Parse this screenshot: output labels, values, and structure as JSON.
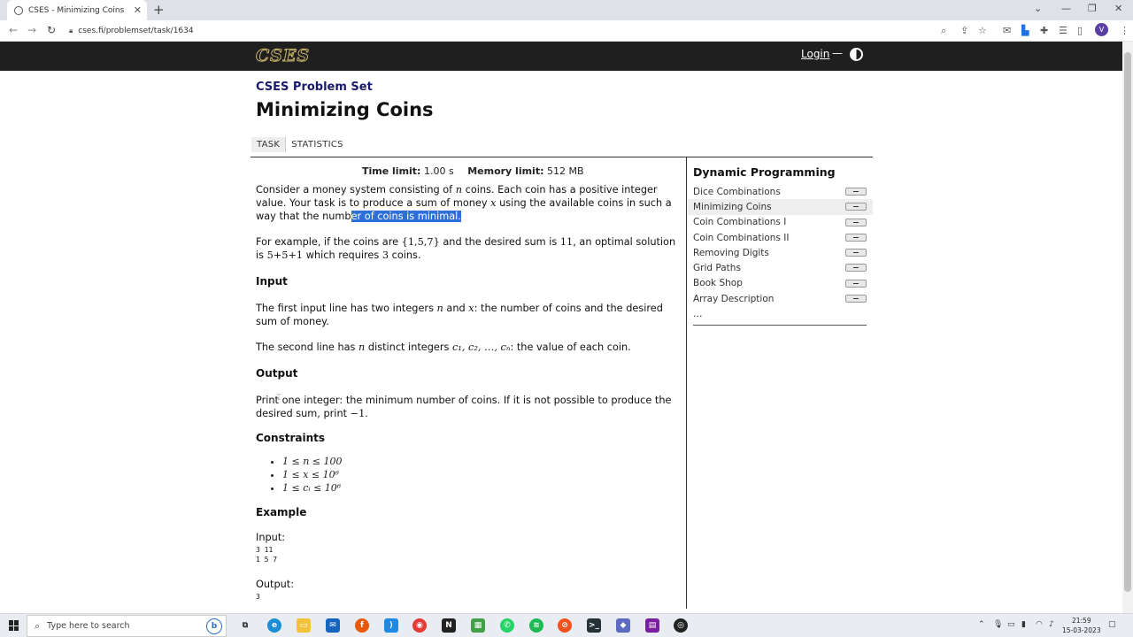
{
  "browser": {
    "tab_title": "CSES - Minimizing Coins",
    "url": "cses.fi/problemset/task/1634",
    "profile_initial": "V"
  },
  "site": {
    "logo": "CSES",
    "login": "Login",
    "dash": "—"
  },
  "page": {
    "problem_set": "CSES Problem Set",
    "title": "Minimizing Coins",
    "tabs": [
      "TASK",
      "STATISTICS"
    ],
    "time_limit_label": "Time limit:",
    "time_limit": "1.00 s",
    "memory_limit_label": "Memory limit:",
    "memory_limit": "512 MB"
  },
  "statement": {
    "p1_a": "Consider a money system consisting of ",
    "p1_n": "n",
    "p1_b": " coins. Each coin has a positive integer value. Your task is to produce a sum of money ",
    "p1_x": "x",
    "p1_c": " using the available coins in such a way that the numb",
    "p1_highlight": "er of coins is minimal.",
    "p2_a": "For example, if the coins are ",
    "p2_set": "{1,5,7}",
    "p2_b": " and the desired sum is ",
    "p2_sum": "11",
    "p2_c": ", an optimal solution is ",
    "p2_expr": "5+5+1",
    "p2_d": " which requires ",
    "p2_three": "3",
    "p2_e": " coins.",
    "input_heading": "Input",
    "in1_a": "The first input line has two integers ",
    "in1_n": "n",
    "in1_b": " and ",
    "in1_x": "x",
    "in1_c": ": the number of coins and the desired sum of money.",
    "in2_a": "The second line has ",
    "in2_n": "n",
    "in2_b": " distinct integers ",
    "in2_c": "c₁, c₂, …, cₙ",
    "in2_d": ": the value of each coin.",
    "output_heading": "Output",
    "out_a": "Print one integer: the minimum number of coins. If it is not possible to produce the desired sum, print ",
    "out_neg": "−1",
    "out_b": ".",
    "constraints_heading": "Constraints",
    "constraints": [
      "1 ≤ n ≤ 100",
      "1 ≤ x ≤ 10⁶",
      "1 ≤ cᵢ ≤ 10⁶"
    ],
    "example_heading": "Example",
    "input_label": "Input:",
    "input_line1": "3 11",
    "input_line2": "1 5 7",
    "output_label": "Output:",
    "output_line1": "3"
  },
  "sidebar": {
    "title": "Dynamic Programming",
    "items": [
      "Dice Combinations",
      "Minimizing Coins",
      "Coin Combinations I",
      "Coin Combinations II",
      "Removing Digits",
      "Grid Paths",
      "Book Shop",
      "Array Description"
    ],
    "current_item": "Minimizing Coins",
    "more": "..."
  },
  "taskbar": {
    "search_placeholder": "Type here to search",
    "time": "21:59",
    "date": "15-03-2023"
  }
}
